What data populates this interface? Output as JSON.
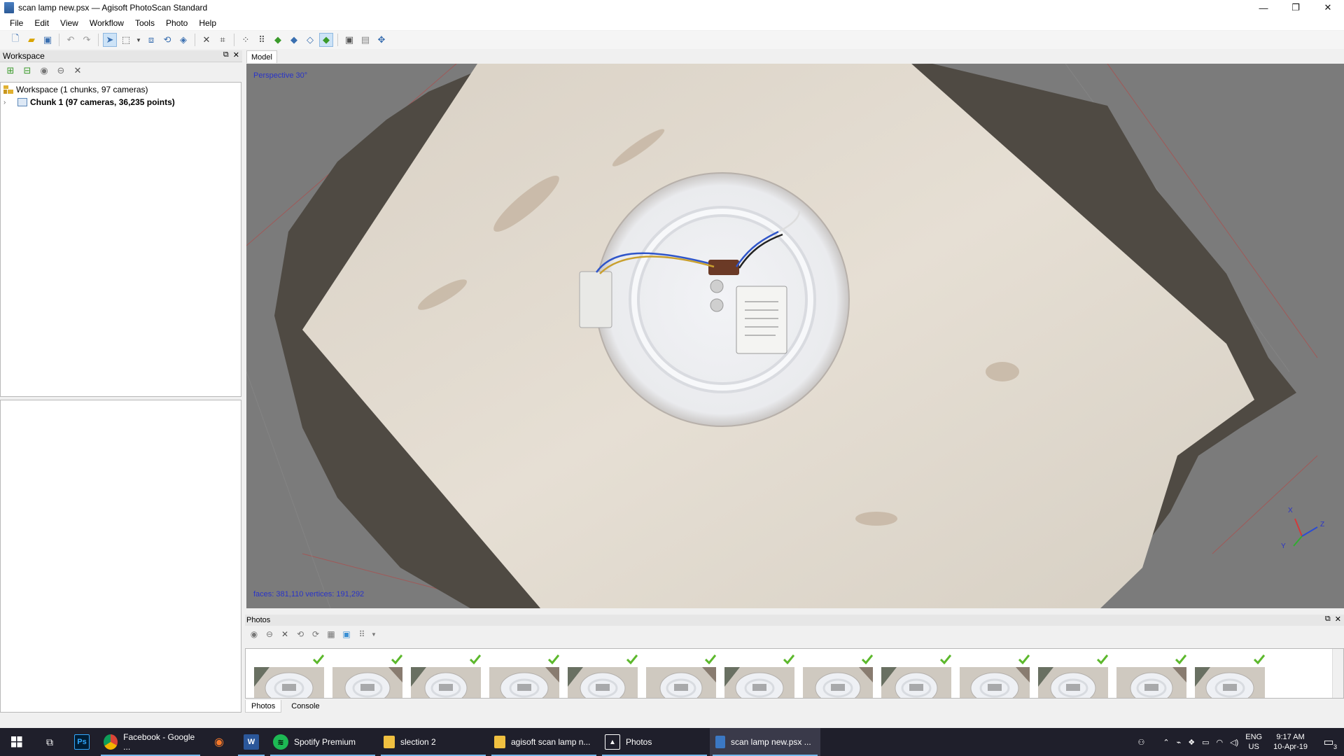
{
  "window": {
    "title": "scan lamp new.psx — Agisoft PhotoScan Standard",
    "controls": [
      "—",
      "❐",
      "✕"
    ]
  },
  "menu": [
    "File",
    "Edit",
    "View",
    "Workflow",
    "Tools",
    "Photo",
    "Help"
  ],
  "workspace_panel": {
    "title": "Workspace",
    "tree": [
      {
        "label": "Workspace (1 chunks, 97 cameras)"
      },
      {
        "label": "Chunk 1 (97 cameras, 36,235 points)"
      }
    ]
  },
  "model_view": {
    "tab_label": "Model",
    "projection": "Perspective 30°",
    "stats": "faces: 381,110 vertices: 191,292",
    "axis_labels": {
      "x": "X",
      "y": "Y",
      "z": "Z"
    }
  },
  "photos_panel": {
    "title": "Photos",
    "thumbnail_count": 13,
    "tabs": [
      "Photos",
      "Console"
    ],
    "selected_tab": "Photos"
  },
  "taskbar": {
    "items": [
      {
        "label": "",
        "icon": "windows-start-icon"
      },
      {
        "label": "",
        "icon": "task-view-icon"
      },
      {
        "label": "",
        "icon": "photoshop-icon",
        "text": "Ps"
      },
      {
        "label": "Facebook - Google ...",
        "icon": "chrome-icon"
      },
      {
        "label": "",
        "icon": "blender-icon"
      },
      {
        "label": "",
        "icon": "word-icon",
        "text": "W"
      },
      {
        "label": "Spotify Premium",
        "icon": "spotify-icon"
      },
      {
        "label": "slection 2",
        "icon": "folder-icon"
      },
      {
        "label": "agisoft scan lamp n...",
        "icon": "folder-icon"
      },
      {
        "label": "Photos",
        "icon": "photos-icon"
      },
      {
        "label": "scan lamp new.psx ...",
        "icon": "photoscan-icon",
        "active": true
      }
    ],
    "tray": {
      "language": "ENG",
      "region": "US",
      "time": "9:17 AM",
      "date": "10-Apr-19",
      "notifications": "3"
    }
  },
  "colors": {
    "viewport_bg": "#7b7b7b",
    "label_blue": "#2a34c8",
    "taskbar_bg": "#1f1f2b",
    "check_green": "#5cb82c"
  }
}
